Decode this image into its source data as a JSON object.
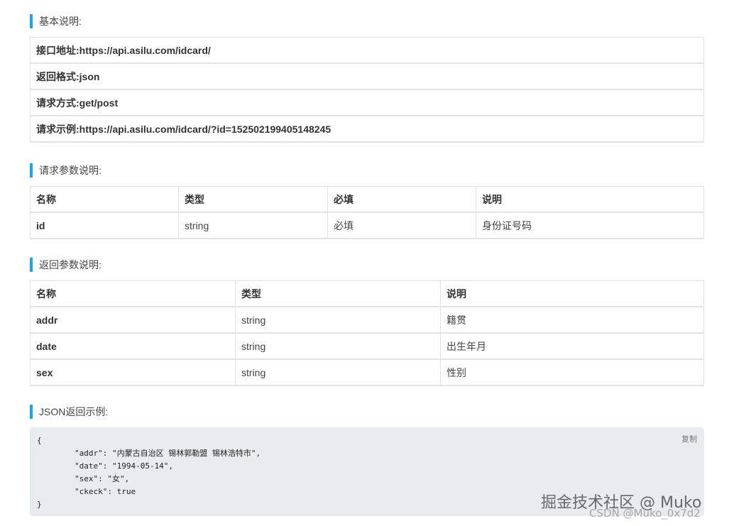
{
  "sections": {
    "basic": "基本说明:",
    "request": "请求参数说明:",
    "response": "返回参数说明:",
    "json": "JSON返回示例:"
  },
  "basic": [
    {
      "label": "接口地址:",
      "value": "https://api.asilu.com/idcard/"
    },
    {
      "label": "返回格式:",
      "value": "json"
    },
    {
      "label": "请求方式:",
      "value": "get/post"
    },
    {
      "label": "请求示例:",
      "value": "https://api.asilu.com/idcard/?id=152502199405148245"
    }
  ],
  "request_table": {
    "headers": [
      "名称",
      "类型",
      "必填",
      "说明"
    ],
    "rows": [
      [
        "id",
        "string",
        "必填",
        "身份证号码"
      ]
    ]
  },
  "response_table": {
    "headers": [
      "名称",
      "类型",
      "说明"
    ],
    "rows": [
      [
        "addr",
        "string",
        "籍贯"
      ],
      [
        "date",
        "string",
        "出生年月"
      ],
      [
        "sex",
        "string",
        "性别"
      ]
    ]
  },
  "json_example": {
    "copy_label": "复制",
    "code": "{\n        \"addr\": \"内蒙古自治区 锡林郭勒盟 锡林浩特市\",\n        \"date\": \"1994-05-14\",\n        \"sex\": \"女\",\n        \"ckeck\": true\n}"
  },
  "watermark": {
    "main": "掘金技术社区 @ Muko",
    "sub": "CSDN @Muko_0x7d2"
  }
}
